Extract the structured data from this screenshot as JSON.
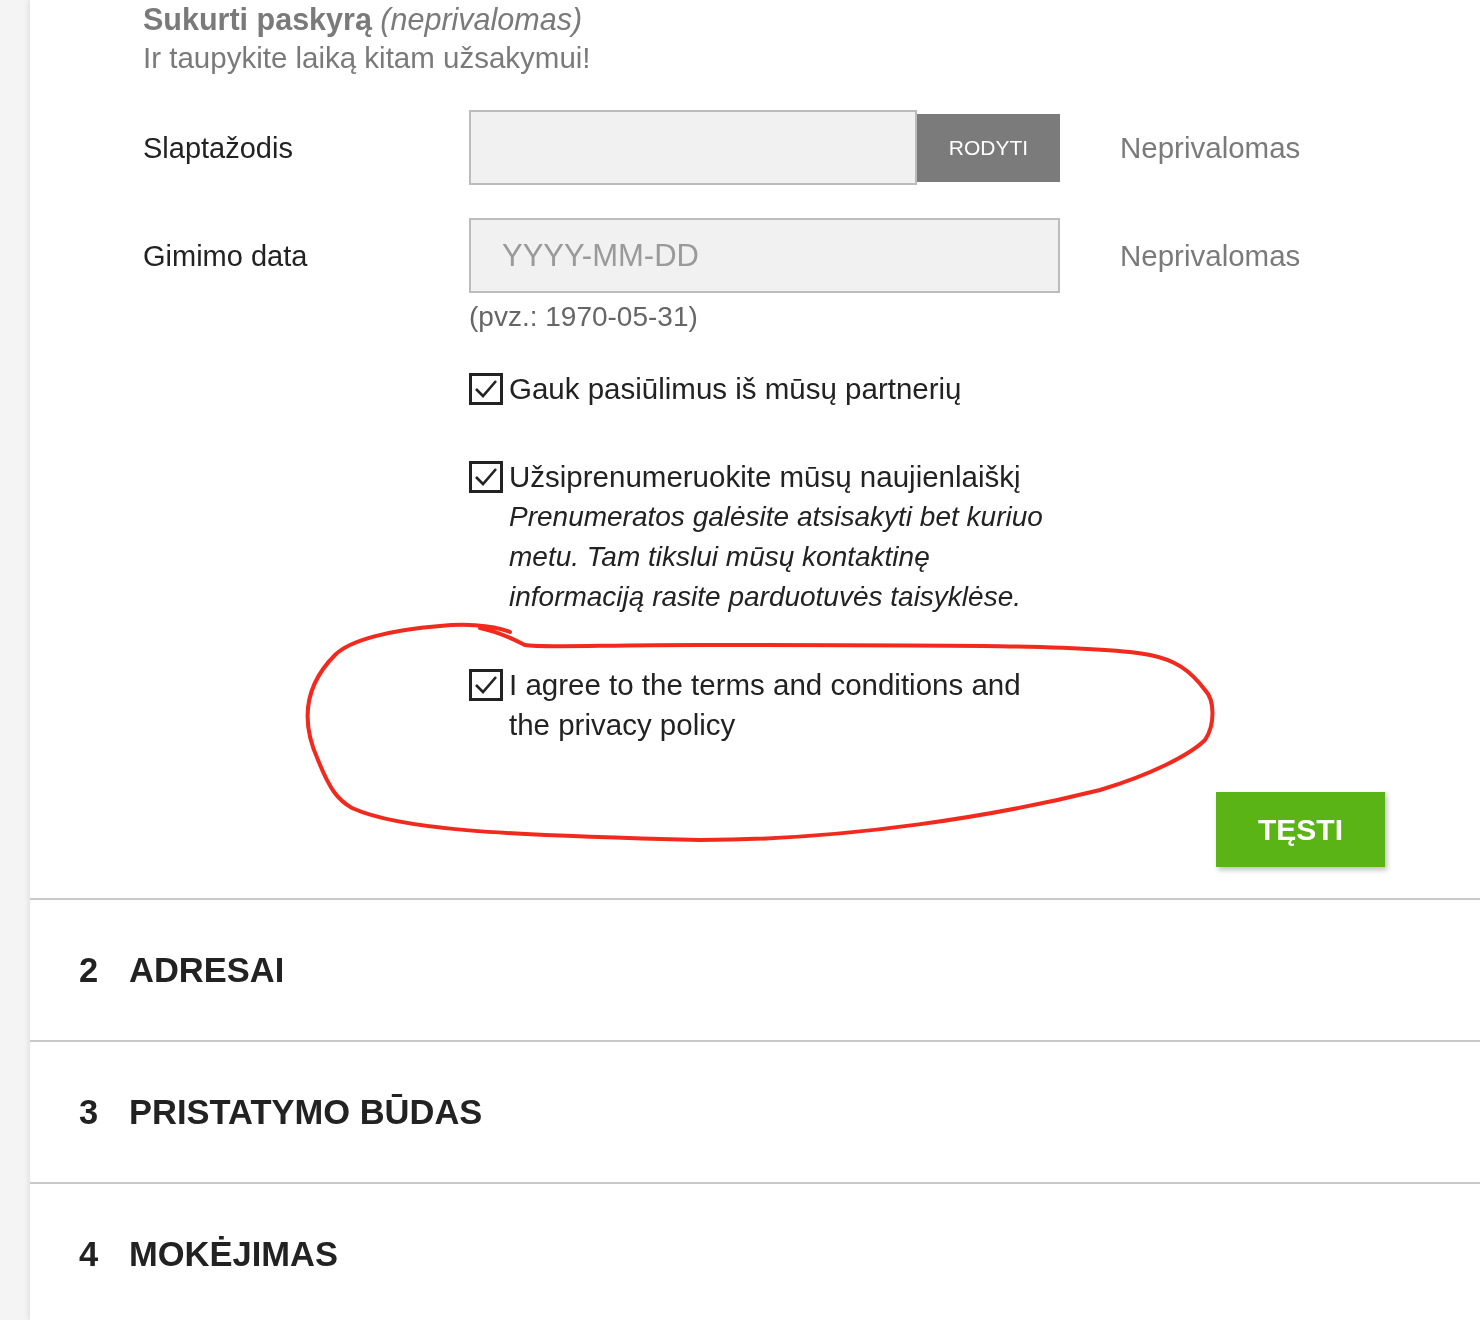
{
  "account": {
    "heading": "**Sukurti paskyrą** *(neprivalomas)*",
    "subtitle": "Ir taupykite laiką kitam užsakymui!",
    "fields": [
      {
        "kind": "password",
        "label": "Slaptažodis",
        "button": "RODYTI",
        "note": "Neprivalomas"
      },
      {
        "kind": "date",
        "label": "Gimimo data",
        "placeholder": "YYYY-MM-DD",
        "note": "Neprivalomas",
        "hint": "(pvz.: 1970-05-31)"
      }
    ],
    "checkboxes": [
      {
        "label": "Gauk pasiūlimus iš mūsų partnerių",
        "checked": true,
        "circled": false
      },
      {
        "label": "Užsiprenumeruokite mūsų naujienlaiškį",
        "checked": true,
        "circled": false,
        "note": "Prenumeratos galėsite atsisakyti bet kuriuo metu. Tam tikslui mūsų kontaktinę informaciją rasite parduotuvės taisyklėse."
      },
      {
        "label": "I agree to the terms and conditions and the privacy policy",
        "checked": true,
        "circled": true
      }
    ],
    "continue_button": "TĘSTI"
  },
  "steps": [
    {
      "number": "2",
      "title": "ADRESAI"
    },
    {
      "number": "3",
      "title": "PRISTATYMO BŪDAS"
    },
    {
      "number": "4",
      "title": "MOKĖJIMAS"
    }
  ]
}
